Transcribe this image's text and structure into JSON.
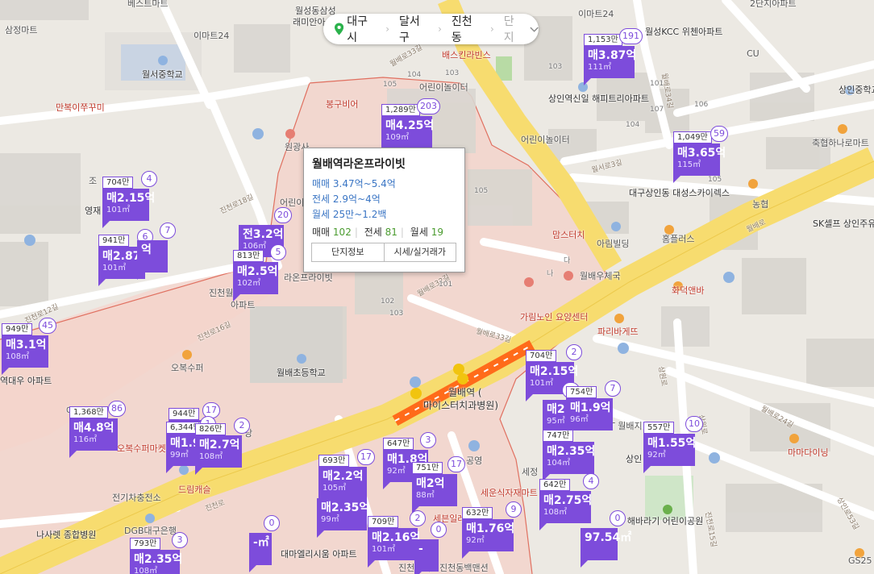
{
  "breadcrumb": {
    "city": "대구시",
    "district": "달서구",
    "dong": "진천동",
    "complex": "단지"
  },
  "popup": {
    "title": "월배역라온프라이빗",
    "sale_range": "매매 3.47억~5.4억",
    "jeonse_range": "전세 2.9억~4억",
    "monthly_range": "월세 25만~1.2백",
    "sale_label": "매매",
    "sale_count": "102",
    "jeonse_label": "전세",
    "jeonse_count": "81",
    "monthly_label": "월세",
    "monthly_count": "19",
    "btn_info": "단지정보",
    "btn_price": "시세/실거래가"
  },
  "markers": [
    {
      "top": "1,289만",
      "count": "203",
      "price": "매4.25억",
      "area": "109㎡"
    },
    {
      "top": "1,153만",
      "count": "191",
      "price": "매3.87억",
      "area": "111㎡"
    },
    {
      "top": "1,049만",
      "count": "59",
      "price": "매3.65억",
      "area": "115㎡"
    },
    {
      "top": "704만",
      "count": "4",
      "price": "매2.15억",
      "area": "101㎡"
    },
    {
      "top": "",
      "count": "20",
      "price": "전3.2억",
      "area": "106㎡"
    },
    {
      "top": "941만",
      "count": "6",
      "price": "매2.87억",
      "area": "101㎡"
    },
    {
      "top": "",
      "count": "7",
      "price": "억",
      "area": ""
    },
    {
      "top": "813만",
      "count": "5",
      "price": "매2.5억",
      "area": "102㎡"
    },
    {
      "top": "949만",
      "count": "45",
      "price": "매3.1억",
      "area": "108㎡"
    },
    {
      "top": "1,368만",
      "count": "86",
      "price": "매4.8억",
      "area": "116㎡"
    },
    {
      "top": "944만",
      "count": "17",
      "price": "",
      "area": ""
    },
    {
      "top": "6,344만",
      "count": "1",
      "price": "매1.9억",
      "area": "99㎡"
    },
    {
      "top": "826만",
      "count": "2",
      "price": "매2.7억",
      "area": "108㎡"
    },
    {
      "top": "704만",
      "count": "2",
      "price": "매2.15억",
      "area": "101㎡"
    },
    {
      "top": "",
      "count": "10",
      "price": "매2",
      "area": "95㎡"
    },
    {
      "top": "754만",
      "count": "7",
      "price": "매1.9억",
      "area": "96㎡"
    },
    {
      "top": "557만",
      "count": "10",
      "price": "매1.55억",
      "area": "92㎡"
    },
    {
      "top": "747만",
      "count": "",
      "price": "매2.35억",
      "area": "104㎡"
    },
    {
      "top": "642만",
      "count": "4",
      "price": "매2.75억",
      "area": "108㎡"
    },
    {
      "top": "",
      "count": "0",
      "price": "97.54㎡",
      "area": ""
    },
    {
      "top": "647만",
      "count": "3",
      "price": "매1.8억",
      "area": "92㎡"
    },
    {
      "top": "751만",
      "count": "17",
      "price": "매2억",
      "area": "88㎡"
    },
    {
      "top": "693만",
      "count": "17",
      "price": "매2.2억",
      "area": "105㎡"
    },
    {
      "top": "",
      "count": "",
      "price": "매2.35억",
      "area": "99㎡"
    },
    {
      "top": "709만",
      "count": "2",
      "price": "매2.16억",
      "area": "101㎡"
    },
    {
      "top": "",
      "count": "0",
      "price": "-",
      "area": ""
    },
    {
      "top": "632만",
      "count": "9",
      "price": "매1.76억",
      "area": "92㎡"
    },
    {
      "top": "",
      "count": "0",
      "price": "-㎡",
      "area": ""
    },
    {
      "top": "793만",
      "count": "3",
      "price": "매2.35억",
      "area": "108㎡"
    }
  ],
  "labels": {
    "l1": "베스트마트",
    "l2": "월성동삼성",
    "l3": "래미안아",
    "l4": "이마트24",
    "l5": "삼정마트",
    "l6": "이마트24",
    "l7": "월서중학교",
    "l8": "만복이쭈꾸미",
    "l9": "원광사",
    "l10": "봉구비어",
    "l11": "어린이놀이터",
    "l12": "배스킨라빈스",
    "l13": "CU",
    "l14": "2단지아파트",
    "l15": "이마트24",
    "l16": "월성KCC 위첸아파트",
    "l17": "상인역신일 해피트리아파트",
    "l18": "어린이놀이터",
    "l19": "상인중학교 아파트",
    "l20": "축협하나로마트",
    "l21": "대구상인동 대성스카이렉스",
    "l22": "농협",
    "l23": "SK셀프 상인주유소",
    "l24": "홈플러스",
    "l25": "아림빌딩",
    "l26": "맘스터치",
    "l27": "월배우체국",
    "l28": "화덕앤바",
    "l29": "가림노인 요양센터",
    "l30": "파리바게뜨",
    "l31": "월배초등학교",
    "l32": "월배역 (",
    "l33": "마이스터치과병원)",
    "l34": "오복수퍼",
    "l35": "진천역",
    "l36": "역대우 아파트",
    "l37": "진천월",
    "l38": "영재 실내",
    "l39": "오복수퍼마켓",
    "l40": "드림캐슬",
    "l41": "전기차충전소",
    "l42": "DGB대구은행",
    "l43": "나사렛 종합병원",
    "l44": "대마엘리시움 아파트",
    "l45": "세븐일레",
    "l46": "세정",
    "l47": "세운식자재마트",
    "l48": "공영",
    "l49": "진천동백맨션",
    "l50": "해바라기 어린이공원",
    "l51": "마마다이닝",
    "l52": "GS25",
    "l53": "진천장미",
    "l54": "상인",
    "l55": "T 월배지",
    "l56": "어린이",
    "l57": "라온프라이빗",
    "l58": "원광사",
    "l59": "조",
    "l60": "아파트",
    "l61": "당",
    "l62": "보",
    "l63": "석",
    "l64": "아"
  },
  "roads": {
    "r1": "월배로33길",
    "r2": "월서로3길",
    "r3": "진천로18길",
    "r4": "월배로33길",
    "r5": "월배로",
    "r6": "진천로16길",
    "r7": "진천로12길",
    "r8": "월배로32길",
    "r9": "진천로",
    "r10": "월배로",
    "r11": "상원로",
    "r12": "진천로15길",
    "r13": "월배로",
    "r14": "상인로53길",
    "r15": "월배로24길",
    "r16": "월서로",
    "r17": "월배로34길",
    "r18": "상원로"
  },
  "numbers": {
    "n1": "103",
    "n2": "101",
    "n3": "104",
    "n4": "106",
    "n5": "104",
    "n6": "105",
    "n7": "103",
    "n8": "102",
    "n9": "107",
    "n10": "108",
    "n11": "102",
    "n12": "105",
    "n13": "102",
    "n14": "103",
    "n15": "103",
    "n16": "107",
    "n17": "108",
    "n18": "105",
    "n19": "104",
    "n20": "101",
    "n21": "나",
    "n22": "다",
    "n23": "4",
    "n24": "1"
  },
  "colors": {
    "marker": "#7d4cdb",
    "sale_text": "#3a75c4",
    "count_text": "#4a9b2f",
    "highlight_area": "#f4d6cf",
    "highlight_border": "#e07060",
    "road_yellow": "#f7dc6f",
    "station": "#ff6b1a"
  }
}
